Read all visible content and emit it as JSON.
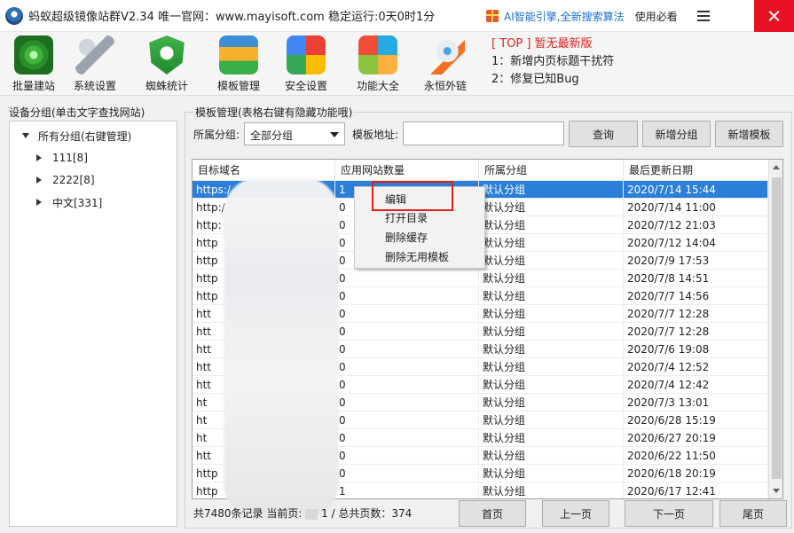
{
  "window": {
    "title": "蚂蚁超级镜像站群V2.34 唯一官网：www.mayisoft.com 稳定运行:0天0时1分",
    "ai_text": "AI智能引擎,全新搜索算法",
    "help": "使用必看"
  },
  "toolbar": {
    "items": [
      {
        "label": "批量建站",
        "icon": "radar-icon"
      },
      {
        "label": "系统设置",
        "icon": "wrench-icon"
      },
      {
        "label": "蜘蛛统计",
        "icon": "spider-shield-icon"
      },
      {
        "label": "模板管理",
        "icon": "template-icon"
      },
      {
        "label": "安全设置",
        "icon": "security-icon"
      },
      {
        "label": "功能大全",
        "icon": "apps-icon"
      },
      {
        "label": "永恒外链",
        "icon": "rocket-icon"
      }
    ],
    "notes": {
      "top": "[ TOP ] 暂无最新版",
      "line1": "1：新增内页标题干扰符",
      "line2": "2：修复已知Bug"
    }
  },
  "left_panel": {
    "title": "设备分组(单击文字查找网站)",
    "root": "所有分组(右键管理)",
    "children": [
      "111[8]",
      "2222[8]",
      "中文[331]"
    ]
  },
  "right_panel": {
    "title": "模板管理(表格右键有隐藏功能哦)",
    "group_label": "所属分组:",
    "group_value": "全部分组",
    "addr_label": "模板地址:",
    "addr_value": "",
    "buttons": {
      "query": "查询",
      "add_group": "新增分组",
      "add_template": "新增模板"
    }
  },
  "table": {
    "columns": [
      "目标域名",
      "应用网站数量",
      "所属分组",
      "最后更新日期"
    ],
    "rows": [
      {
        "domain": "https:/",
        "count": "1",
        "group": "默认分组",
        "date": "2020/7/14 15:44"
      },
      {
        "domain": "http:/",
        "count": "0",
        "group": "默认分组",
        "date": "2020/7/14 11:00"
      },
      {
        "domain": "http:",
        "count": "0",
        "group": "默认分组",
        "date": "2020/7/12 21:03"
      },
      {
        "domain": "http",
        "count": "0",
        "group": "默认分组",
        "date": "2020/7/12 14:04"
      },
      {
        "domain": "http",
        "count": "0",
        "group": "默认分组",
        "date": "2020/7/9 17:53"
      },
      {
        "domain": "http",
        "count": "0",
        "group": "默认分组",
        "date": "2020/7/8 14:51"
      },
      {
        "domain": "http",
        "count": "0",
        "group": "默认分组",
        "date": "2020/7/7 14:56"
      },
      {
        "domain": "htt",
        "count": "0",
        "group": "默认分组",
        "date": "2020/7/7 12:28"
      },
      {
        "domain": "htt",
        "count": "0",
        "group": "默认分组",
        "date": "2020/7/7 12:28"
      },
      {
        "domain": "htt",
        "count": "0",
        "group": "默认分组",
        "date": "2020/7/6 19:08"
      },
      {
        "domain": "htt",
        "count": "0",
        "group": "默认分组",
        "date": "2020/7/4 12:52"
      },
      {
        "domain": "htt",
        "count": "0",
        "group": "默认分组",
        "date": "2020/7/4 12:42"
      },
      {
        "domain": "ht",
        "count": "0",
        "group": "默认分组",
        "date": "2020/7/3 13:01"
      },
      {
        "domain": "ht",
        "count": "0",
        "group": "默认分组",
        "date": "2020/6/28 15:19"
      },
      {
        "domain": "ht",
        "count": "0",
        "group": "默认分组",
        "date": "2020/6/27 20:19"
      },
      {
        "domain": "htt",
        "count": "0",
        "group": "默认分组",
        "date": "2020/6/22 11:50"
      },
      {
        "domain": "http",
        "count": "0",
        "group": "默认分组",
        "date": "2020/6/18 20:19"
      },
      {
        "domain": "http",
        "count": "1",
        "group": "默认分组",
        "date": "2020/6/17 12:41"
      }
    ]
  },
  "context_menu": {
    "items": [
      "编辑",
      "打开目录",
      "删除缓存",
      "删除无用模板"
    ]
  },
  "footer": {
    "records": "共7480条记录",
    "current_label": "当前页:",
    "page_info": "1 / 总共页数：374",
    "buttons": {
      "first": "首页",
      "prev": "上一页",
      "next": "下一页",
      "last": "尾页"
    }
  },
  "colors": {
    "selected_row": "#2b7fd9",
    "close": "#e81123",
    "accent_red": "#e0201a",
    "ai_blue": "#1b6fd0"
  }
}
